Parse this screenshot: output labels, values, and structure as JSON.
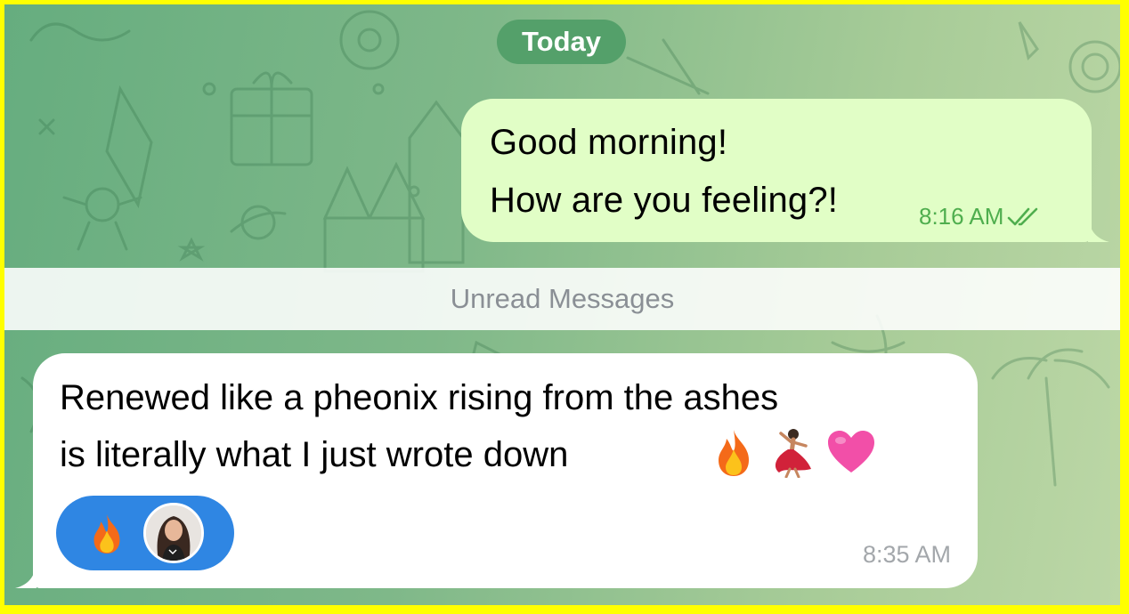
{
  "chat": {
    "date_label": "Today",
    "unread_label": "Unread Messages",
    "outgoing": {
      "line1": "Good morning!",
      "line2": "How are you feeling?!",
      "time": "8:16 AM",
      "status": "read-double-check-icon"
    },
    "incoming": {
      "line1": "Renewed like a pheonix rising from the ashes",
      "line2": "is literally what I just wrote down",
      "emojis": [
        "fire-icon",
        "dancer-icon",
        "pink-heart-icon"
      ],
      "time": "8:35 AM",
      "reaction": {
        "emoji": "fire-icon",
        "reactor": "avatar"
      }
    }
  },
  "colors": {
    "outgoing_bubble": "#e1fec6",
    "incoming_bubble": "#ffffff",
    "date_pill": "#54a06a",
    "read_check": "#4fae4e",
    "reaction_pill": "#2f86e3",
    "frame_border": "#ffff00"
  }
}
